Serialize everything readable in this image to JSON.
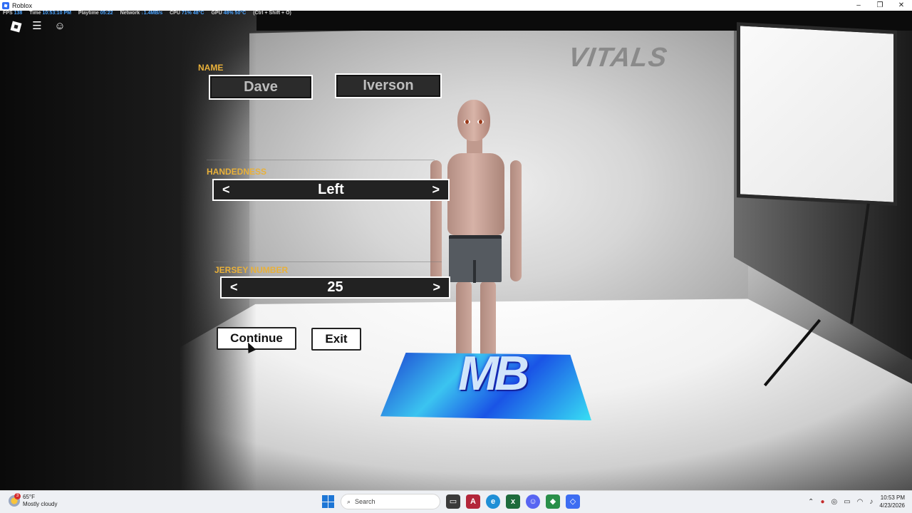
{
  "window": {
    "title": "Roblox",
    "controls": [
      "–",
      "❐",
      "✕"
    ]
  },
  "stats_bar": {
    "fps_label": "FPS",
    "fps": "138",
    "time_label": "Time",
    "time": "10:53:10 PM",
    "playtime_label": "Playtime",
    "playtime": "05:22",
    "network_label": "Network",
    "network": "↓1.4MB/s",
    "cpu_label": "CPU",
    "cpu": "71%",
    "cpu_temp": "48°C",
    "gpu_label": "GPU",
    "gpu": "48%",
    "gpu_temp": "50°C",
    "shortcut": "(Ctrl + Shift + O)"
  },
  "scene": {
    "wall_text": "VITALS",
    "mat_logo": "MB"
  },
  "menu": {
    "name_label": "NAME",
    "first_name": "Dave",
    "last_name": "Iverson",
    "handedness_label": "HANDEDNESS",
    "handedness_value": "Left",
    "jersey_label": "JERSEY NUMBER",
    "jersey_value": "25",
    "prev_arrow": "<",
    "next_arrow": ">",
    "continue_label": "Continue",
    "exit_label": "Exit"
  },
  "taskbar": {
    "weather_temp": "65°F",
    "weather_desc": "Mostly cloudy",
    "weather_badge": "3",
    "search_placeholder": "Search",
    "time": "10:53 PM",
    "date": "4/23/2026"
  },
  "colors": {
    "label_gold": "#e9b13a",
    "accent_blue": "#4aa3ff"
  }
}
